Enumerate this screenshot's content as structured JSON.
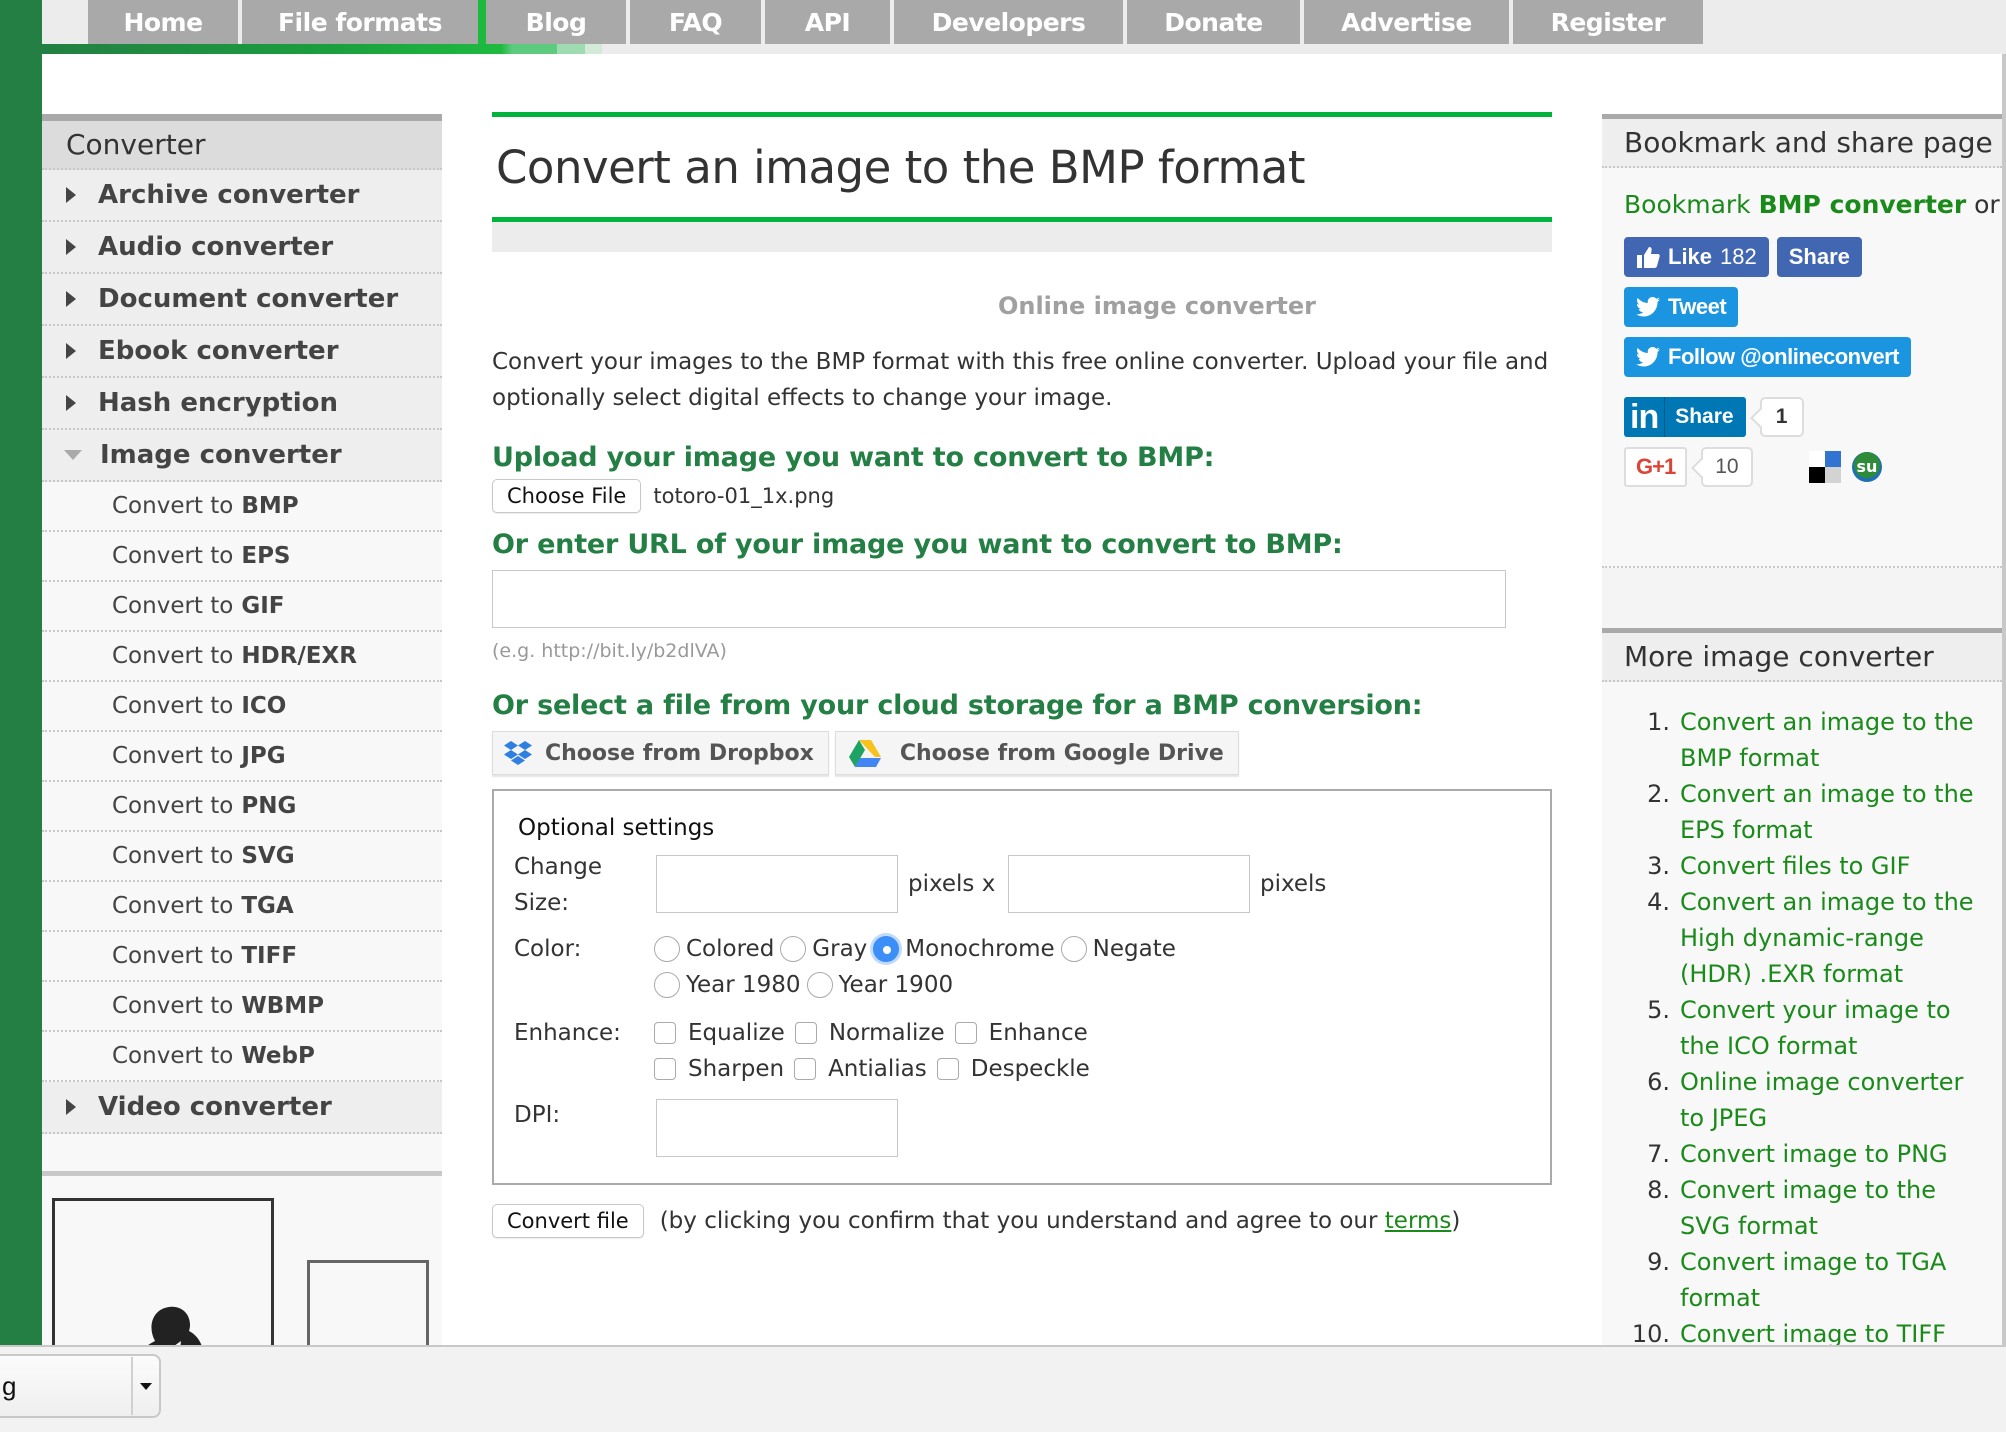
{
  "topnav": {
    "tabs": [
      "Home",
      "File formats",
      "Blog",
      "FAQ",
      "API",
      "Developers",
      "Donate",
      "Advertise",
      "Register"
    ]
  },
  "left_sidebar": {
    "title": "Converter",
    "categories_before": [
      "Archive converter",
      "Audio converter",
      "Document converter",
      "Ebook converter",
      "Hash encryption"
    ],
    "expanded_category": "Image converter",
    "sub_prefix": "Convert to",
    "sub_items": [
      "BMP",
      "EPS",
      "GIF",
      "HDR/EXR",
      "ICO",
      "JPG",
      "PNG",
      "SVG",
      "TGA",
      "TIFF",
      "WBMP",
      "WebP"
    ],
    "categories_after": [
      "Video converter"
    ]
  },
  "main": {
    "title": "Convert an image to the BMP format",
    "subtitle": "Online image converter",
    "intro": "Convert your images to the BMP format with this free online converter. Upload your file and optionally select digital effects to change your image.",
    "upload_heading": "Upload your image you want to convert to BMP:",
    "choose_file_label": "Choose File",
    "chosen_file": "totoro-01_1x.png",
    "url_heading": "Or enter URL of your image you want to convert to BMP:",
    "url_value": "",
    "url_hint": "(e.g. http://bit.ly/b2dlVA)",
    "cloud_heading": "Or select a file from your cloud storage for a BMP conversion:",
    "dropbox_label": "Choose from Dropbox",
    "gdrive_label": "Choose from Google Drive",
    "optional": {
      "title": "Optional settings",
      "size_label_1": "Change",
      "size_label_2": "Size:",
      "width_value": "",
      "height_value": "",
      "pixels_x": "pixels x",
      "pixels": "pixels",
      "color_label": "Color:",
      "color_options": [
        "Colored",
        "Gray",
        "Monochrome",
        "Negate",
        "Year 1980",
        "Year 1900"
      ],
      "color_selected": "Monochrome",
      "enhance_label": "Enhance:",
      "enhance_options": [
        "Equalize",
        "Normalize",
        "Enhance",
        "Sharpen",
        "Antialias",
        "Despeckle"
      ],
      "enhance_checked": [],
      "dpi_label": "DPI:",
      "dpi_value": ""
    },
    "convert_label": "Convert file",
    "convert_note_pre": "(by clicking you confirm that you understand and agree to our ",
    "terms_link": "terms",
    "convert_note_post": ")"
  },
  "right_sidebar": {
    "bookmark_title": "Bookmark and share page",
    "bookmark_text": "Bookmark",
    "bookmark_bold": "BMP converter",
    "bookmark_or": "or",
    "fb_like": "Like",
    "fb_like_count": "182",
    "fb_share": "Share",
    "tweet": "Tweet",
    "follow": "Follow @onlineconvert",
    "linkedin_in": "in",
    "linkedin_share": "Share",
    "linkedin_count": "1",
    "gplus": "G+1",
    "gplus_count": "10",
    "more_title": "More image converter",
    "more_items": [
      "Convert an image to the BMP format",
      "Convert an image to the EPS format",
      "Convert files to GIF",
      "Convert an image to the High dynamic-range (HDR) .EXR format",
      "Convert your image to the ICO format",
      "Online image converter to JPEG",
      "Convert image to PNG",
      "Convert image to the SVG format",
      "Convert image to TGA format",
      "Convert image to TIFF format"
    ]
  },
  "bottom_bar": {
    "dropdown_value": "g"
  },
  "colors": {
    "brand_green": "#237f43",
    "accent_green": "#00b33c",
    "link_green": "#1a8a1a",
    "nav_grey": "#a9a9a9",
    "facebook": "#4267b2",
    "twitter": "#1b95e0",
    "linkedin": "#0077b5",
    "radio_selected": "#3b8ff6"
  }
}
